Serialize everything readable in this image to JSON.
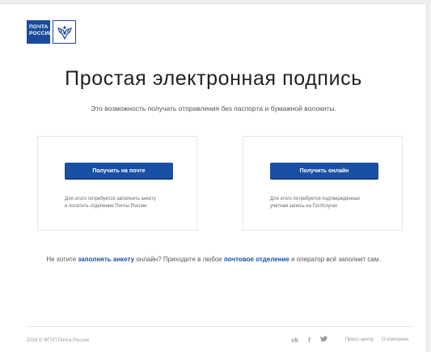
{
  "logo": {
    "line1": "ПОЧТА",
    "line2": "РОССИИ",
    "emblem_icon": "eagle-emblem-icon"
  },
  "title": "Простая электронная подпись",
  "subtitle": "Это возможность получать отправления без паспорта и бумажной волокиты.",
  "cards": [
    {
      "button_label": "Получить на почте",
      "desc_line1": "Для этого потребуется заполнить анкету",
      "desc_line2": "и посетить отделение Почты России"
    },
    {
      "button_label": "Получить онлайн",
      "desc_line1": "Для этого потребуется подтверждённая",
      "desc_line2": "учётная запись на ГосУслугах"
    }
  ],
  "bottom": {
    "part1": "Не хотите ",
    "link1": "заполнять анкету",
    "part2": " онлайн? Приходите в любое ",
    "link2": "почтовое отделение",
    "part3": " и оператор всё заполнит сам."
  },
  "footer": {
    "copyright": "2018 © ФГУП Почта России",
    "vk": "vk-icon",
    "facebook": "facebook-icon",
    "twitter": "twitter-icon",
    "press": "Пресс-центр",
    "about": "О компании"
  },
  "colors": {
    "brand_blue": "#1a4fa6",
    "button_blue": "#1a4fa6"
  }
}
